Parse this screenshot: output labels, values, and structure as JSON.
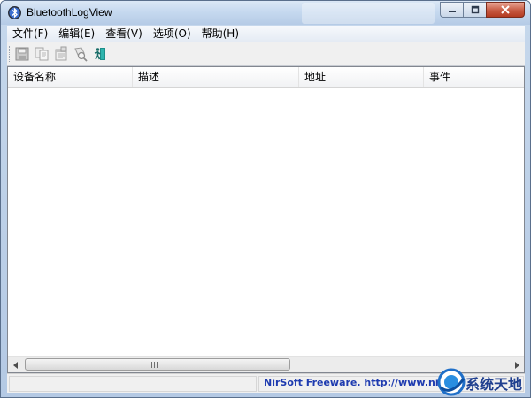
{
  "window": {
    "title": "BluetoothLogView"
  },
  "menu": {
    "items": [
      {
        "label": "文件(F)"
      },
      {
        "label": "编辑(E)"
      },
      {
        "label": "查看(V)"
      },
      {
        "label": "选项(O)"
      },
      {
        "label": "帮助(H)"
      }
    ]
  },
  "toolbar": {
    "buttons": [
      {
        "icon": "save-icon"
      },
      {
        "icon": "copy-icon"
      },
      {
        "icon": "properties-icon"
      },
      {
        "icon": "find-icon"
      },
      {
        "icon": "exit-icon"
      }
    ]
  },
  "table": {
    "columns": [
      {
        "label": "设备名称"
      },
      {
        "label": "描述"
      },
      {
        "label": "地址"
      },
      {
        "label": "事件"
      }
    ],
    "rows": []
  },
  "statusbar": {
    "text": "NirSoft Freeware.  http://www.nirsoft.net"
  },
  "watermark": {
    "text": "系统天地"
  },
  "colors": {
    "status_link": "#1e3bb0",
    "close_button": "#c75a42",
    "watermark": "#1f3f8f"
  }
}
